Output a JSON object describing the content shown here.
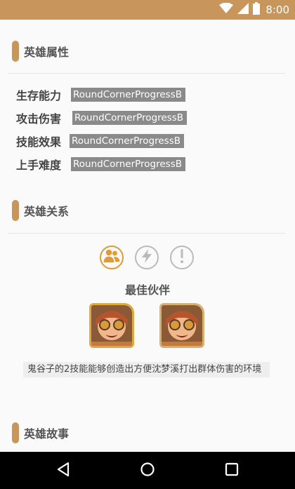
{
  "status_bar": {
    "time": "8:00",
    "icons": [
      "wifi-icon",
      "signal-icon",
      "battery-icon"
    ],
    "color": "#c8965a"
  },
  "sections": {
    "attributes": {
      "title": "英雄属性"
    },
    "relations": {
      "title": "英雄关系"
    },
    "story": {
      "title": "英雄故事"
    }
  },
  "attributes": [
    {
      "label": "生存能力",
      "bar_text": "RoundCornerProgressB"
    },
    {
      "label": "攻击伤害",
      "bar_text": "RoundCornerProgressB"
    },
    {
      "label": "技能效果",
      "bar_text": "RoundCornerProgressB"
    },
    {
      "label": "上手难度",
      "bar_text": "RoundCornerProgressB"
    }
  ],
  "relations": {
    "tabs": [
      {
        "icon": "people-icon",
        "active": true
      },
      {
        "icon": "lightning-icon",
        "active": false
      },
      {
        "icon": "exclamation-icon",
        "active": false
      }
    ],
    "current_title": "最佳伙伴",
    "description": "鬼谷子的2技能能够创造出方便沈梦溪打出群体伤害的环境"
  },
  "nav": {
    "icons": [
      "back-icon",
      "home-icon",
      "recents-icon"
    ]
  },
  "accent": "#e09b36"
}
